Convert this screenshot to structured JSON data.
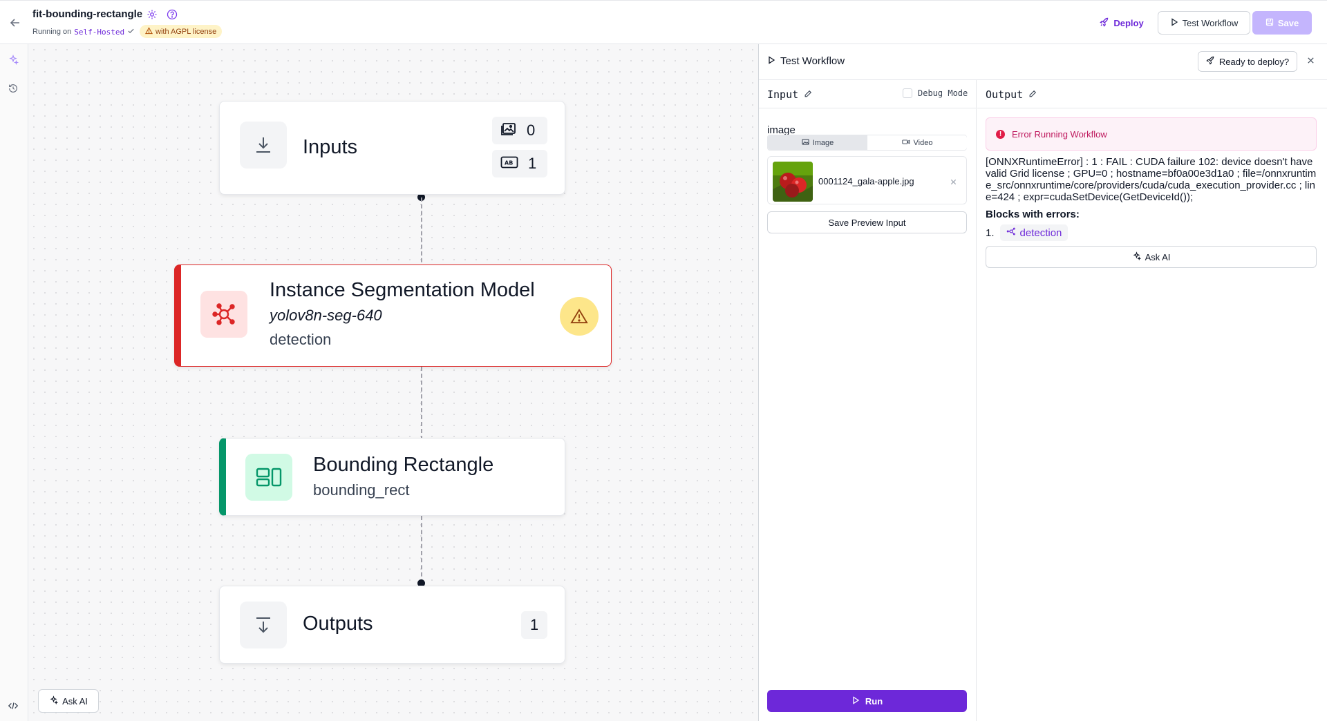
{
  "header": {
    "workflow_name": "fit-bounding-rectangle",
    "running_on_label": "Running on",
    "host": "Self-Hosted",
    "license_badge": "with AGPL license",
    "deploy_label": "Deploy",
    "test_workflow_label": "Test Workflow",
    "save_label": "Save"
  },
  "canvas": {
    "nodes": {
      "inputs": {
        "title": "Inputs",
        "image_count": "0",
        "param_count": "1"
      },
      "model": {
        "title": "Instance Segmentation Model",
        "model_id": "yolov8n-seg-640",
        "name": "detection"
      },
      "bounding": {
        "title": "Bounding Rectangle",
        "name": "bounding_rect"
      },
      "outputs": {
        "title": "Outputs",
        "count": "1"
      }
    },
    "ask_ai_label": "Ask AI"
  },
  "panel": {
    "title": "Test Workflow",
    "ready_label": "Ready to deploy?",
    "input": {
      "header": "Input",
      "debug_label": "Debug Mode",
      "field_label": "image",
      "tab_image": "Image",
      "tab_video": "Video",
      "file_name": "0001124_gala-apple.jpg",
      "save_preview_label": "Save Preview Input",
      "run_label": "Run"
    },
    "output": {
      "header": "Output",
      "error_title": "Error Running Workflow",
      "error_message": "[ONNXRuntimeError] : 1 : FAIL : CUDA failure 102: device doesn't have valid Grid license ; GPU=0 ; hostname=bf0a00e3d1a0 ; file=/onnxruntime_src/onnxruntime/core/providers/cuda/cuda_execution_provider.cc ; line=424 ; expr=cudaSetDevice(GetDeviceId());",
      "blocks_label": "Blocks with errors:",
      "block_index": "1.",
      "block_name": "detection",
      "ask_ai_label": "Ask AI"
    }
  },
  "colors": {
    "accent": "#6d28d9",
    "error_red": "#dc2626",
    "success_green": "#059669",
    "warning_yellow": "#fde68a"
  }
}
